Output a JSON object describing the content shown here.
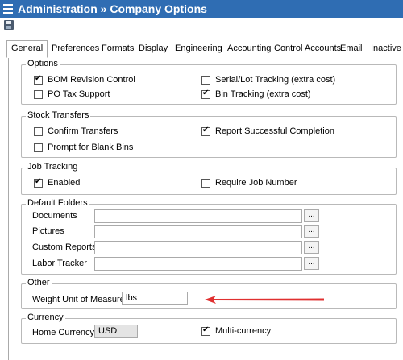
{
  "window": {
    "title": "Administration » Company Options"
  },
  "toolbar": {
    "save_icon": "save-icon"
  },
  "tabs": [
    "General",
    "Preferences",
    "Formats",
    "Display",
    "Engineering",
    "Accounting",
    "Control Accounts",
    "Email",
    "Inactive"
  ],
  "options": {
    "legend": "Options",
    "items": [
      {
        "label": "BOM Revision Control",
        "checked": true
      },
      {
        "label": "PO Tax Support",
        "checked": false
      },
      {
        "label": "Serial/Lot Tracking (extra cost)",
        "checked": false
      },
      {
        "label": "Bin Tracking (extra cost)",
        "checked": true
      }
    ]
  },
  "stock_transfers": {
    "legend": "Stock Transfers",
    "items": [
      {
        "label": "Confirm Transfers",
        "checked": false
      },
      {
        "label": "Prompt for Blank Bins",
        "checked": false
      },
      {
        "label": "Report Successful Completion",
        "checked": true
      }
    ]
  },
  "job_tracking": {
    "legend": "Job Tracking",
    "items": [
      {
        "label": "Enabled",
        "checked": true
      },
      {
        "label": "Require Job Number",
        "checked": false
      }
    ]
  },
  "default_folders": {
    "legend": "Default Folders",
    "browse_label": "...",
    "rows": [
      {
        "label": "Documents",
        "value": ""
      },
      {
        "label": "Pictures",
        "value": ""
      },
      {
        "label": "Custom Reports",
        "value": ""
      },
      {
        "label": "Labor Tracker",
        "value": ""
      }
    ]
  },
  "other": {
    "legend": "Other",
    "weight_label": "Weight Unit of Measure",
    "weight_value": "lbs",
    "arrow_color": "#e03030"
  },
  "currency": {
    "legend": "Currency",
    "home_label": "Home Currency",
    "home_value": "USD",
    "multi_label": "Multi-currency",
    "multi_checked": true
  },
  "colors": {
    "titlebar": "#2f6db3"
  }
}
